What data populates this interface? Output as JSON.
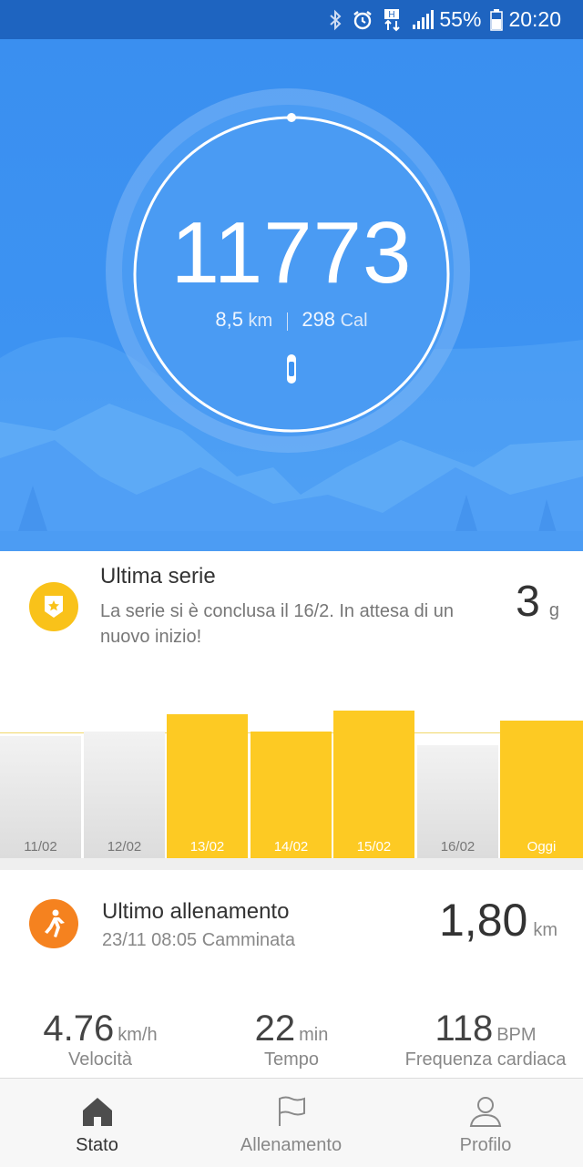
{
  "status_bar": {
    "battery": "55%",
    "time": "20:20",
    "icons": [
      "bluetooth-icon",
      "alarm-icon",
      "data-icon",
      "signal-icon",
      "battery-icon"
    ]
  },
  "hero": {
    "steps": "11773",
    "distance_value": "8,5",
    "distance_unit": "km",
    "calories_value": "298",
    "calories_unit": "Cal",
    "ring_color": "#ffffff",
    "device_icon": "band-icon"
  },
  "streak": {
    "title": "Ultima serie",
    "description": "La serie si è conclusa il 16/2. In attesa di un nuovo inizio!",
    "days_value": "3",
    "days_unit": "g",
    "icon": "badge-icon",
    "bars": [
      {
        "label": "11/02",
        "achieved": false
      },
      {
        "label": "12/02",
        "achieved": false
      },
      {
        "label": "13/02",
        "achieved": true
      },
      {
        "label": "14/02",
        "achieved": true
      },
      {
        "label": "15/02",
        "achieved": true
      },
      {
        "label": "16/02",
        "achieved": false
      },
      {
        "label": "Oggi",
        "achieved": true
      }
    ]
  },
  "chart_data": {
    "type": "bar",
    "categories": [
      "11/02",
      "12/02",
      "13/02",
      "14/02",
      "15/02",
      "16/02",
      "Oggi"
    ],
    "values": [
      0.78,
      0.81,
      0.92,
      0.81,
      0.94,
      0.72,
      0.88
    ],
    "goal": 0.8,
    "title": "",
    "colors": {
      "achieved": "#fdca23",
      "missed": "#e6e6e6",
      "goal_line": "#f1d76a"
    }
  },
  "workout": {
    "title": "Ultimo allenamento",
    "meta": "23/11 08:05 Camminata",
    "distance_value": "1,80",
    "distance_unit": "km",
    "icon": "walking-icon",
    "metrics": [
      {
        "value": "4.76",
        "unit": "km/h",
        "caption": "Velocità"
      },
      {
        "value": "22",
        "unit": "min",
        "caption": "Tempo"
      },
      {
        "value": "118",
        "unit": "BPM",
        "caption": "Frequenza cardiaca"
      }
    ]
  },
  "bottom_nav": [
    {
      "label": "Stato",
      "icon": "home-icon",
      "active": true
    },
    {
      "label": "Allenamento",
      "icon": "flag-icon",
      "active": false
    },
    {
      "label": "Profilo",
      "icon": "profile-icon",
      "active": false
    }
  ],
  "colors": {
    "status_bar": "#1e64c0",
    "hero_blue": "#3d93f2",
    "yellow": "#fdca23",
    "orange": "#f5821f"
  }
}
